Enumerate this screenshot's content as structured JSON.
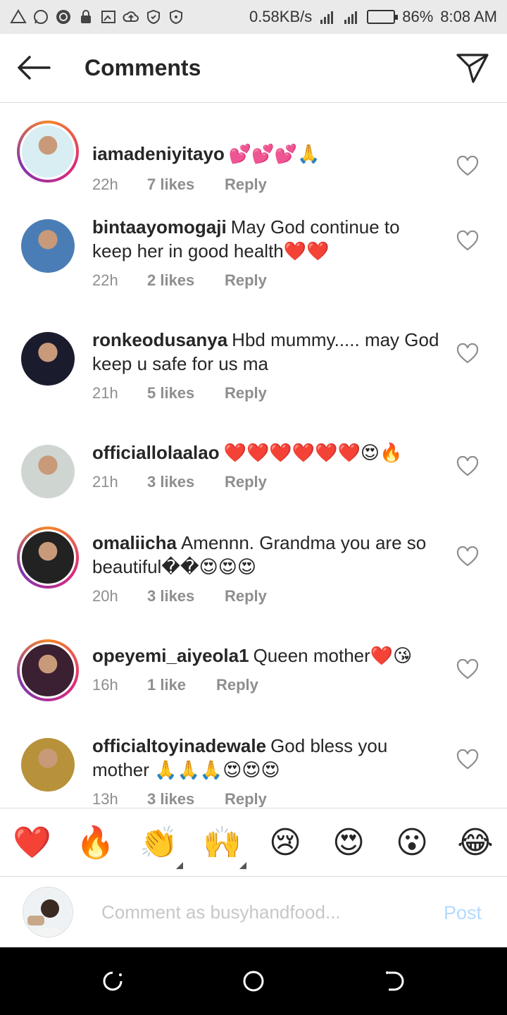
{
  "status_bar": {
    "net_speed": "0.58KB/s",
    "battery_pct": "86%",
    "battery_level": 0.86,
    "time": "8:08 AM",
    "left_icons": [
      "warning-icon",
      "whatsapp-icon",
      "sync-icon",
      "lock-icon",
      "gallery-icon",
      "cloud-upload-icon",
      "shield-icon",
      "shield-check-icon"
    ],
    "right_icons": [
      "signal-hd-icon",
      "signal-icon",
      "battery-icon"
    ]
  },
  "header": {
    "title": "Comments",
    "back_icon": "arrow-left-icon",
    "share_icon": "paper-plane-icon"
  },
  "comments": [
    {
      "username": "iamadeniyitayo",
      "text": "💕💕💕🙏",
      "time": "22h",
      "likes": "7 likes",
      "reply": "Reply",
      "ring": true,
      "avatar_color": "#d9eef2"
    },
    {
      "username": "bintaayomogaji",
      "text": "May God continue to keep her in good health❤️❤️",
      "time": "22h",
      "likes": "2 likes",
      "reply": "Reply",
      "ring": false,
      "avatar_color": "#4a7db5"
    },
    {
      "username": "ronkeodusanya",
      "text": "Hbd mummy..... may God  keep u safe for us ma",
      "time": "21h",
      "likes": "5 likes",
      "reply": "Reply",
      "ring": false,
      "avatar_color": "#1b1b2e"
    },
    {
      "username": "officiallolaalao",
      "text": "❤️❤️❤️❤️❤️❤️😍🔥",
      "time": "21h",
      "likes": "3 likes",
      "reply": "Reply",
      "ring": false,
      "avatar_color": "#cfd6d2"
    },
    {
      "username": "omaliicha",
      "text": "Amennn. Grandma you are so beautiful��😍😍😍",
      "time": "20h",
      "likes": "3 likes",
      "reply": "Reply",
      "ring": true,
      "avatar_color": "#222222"
    },
    {
      "username": "opeyemi_aiyeola1",
      "text": "Queen mother❤️😘",
      "time": "16h",
      "likes": "1 like",
      "reply": "Reply",
      "ring": true,
      "avatar_color": "#3a2030"
    },
    {
      "username": "officialtoyinadewale",
      "text": "God bless you mother 🙏🙏🙏😍😍😍",
      "time": "13h",
      "likes": "3 likes",
      "reply": "Reply",
      "ring": false,
      "avatar_color": "#b8923a"
    }
  ],
  "emoji_bar": [
    "❤️",
    "🔥",
    "👏",
    "🙌",
    "😢",
    "😍",
    "😮",
    "😂"
  ],
  "comment_input": {
    "placeholder": "Comment as busyhandfood...",
    "value": "",
    "post_label": "Post",
    "post_color": "#b3dbff"
  },
  "nav_bar": [
    "recent-apps-icon",
    "home-icon",
    "back-icon"
  ]
}
